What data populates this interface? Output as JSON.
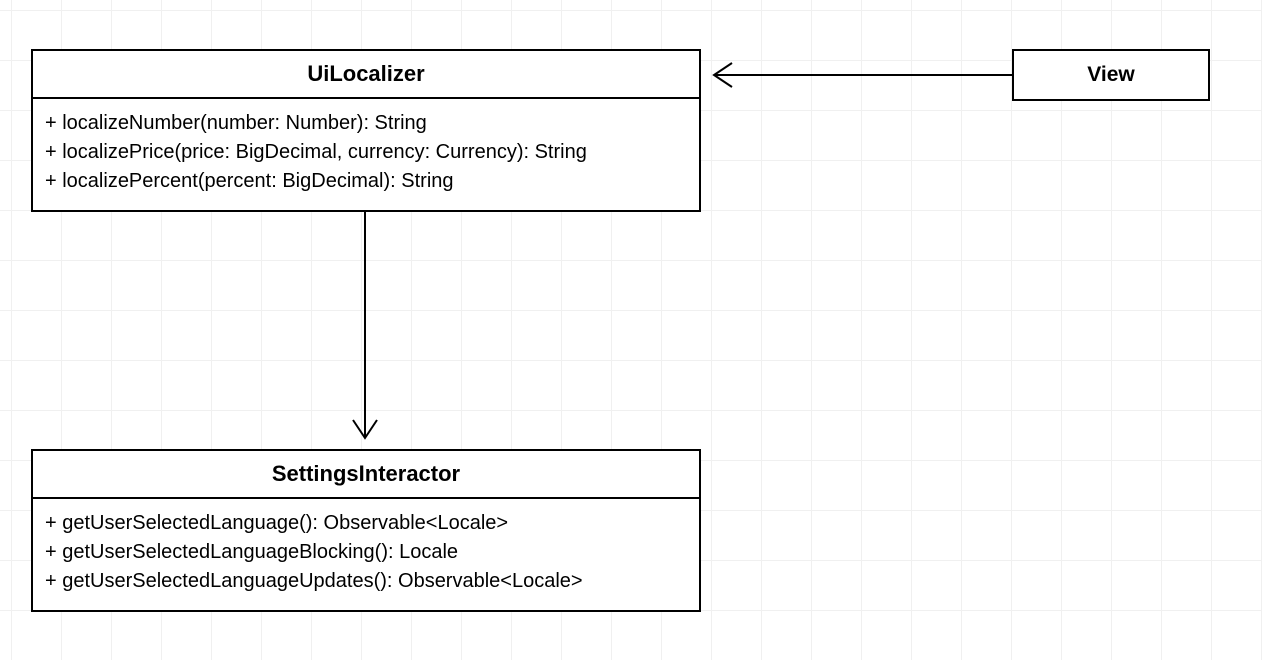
{
  "classes": {
    "uiLocalizer": {
      "name": "UiLocalizer",
      "methods": [
        "+ localizeNumber(number: Number): String",
        "+ localizePrice(price: BigDecimal, currency: Currency): String",
        "+ localizePercent(percent: BigDecimal): String"
      ]
    },
    "settingsInteractor": {
      "name": "SettingsInteractor",
      "methods": [
        "+ getUserSelectedLanguage(): Observable<Locale>",
        "+ getUserSelectedLanguageBlocking(): Locale",
        "+ getUserSelectedLanguageUpdates(): Observable<Locale>"
      ]
    },
    "view": {
      "name": "View"
    }
  },
  "relations": [
    {
      "from": "View",
      "to": "UiLocalizer",
      "type": "association"
    },
    {
      "from": "UiLocalizer",
      "to": "SettingsInteractor",
      "type": "association"
    }
  ]
}
